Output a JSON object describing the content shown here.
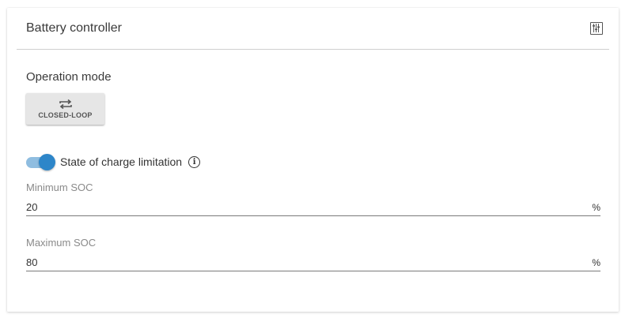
{
  "card": {
    "title": "Battery controller",
    "settings_icon": "sliders-icon"
  },
  "operation_mode": {
    "label": "Operation mode",
    "button_label": "CLOSED-LOOP",
    "button_icon": "repeat-icon"
  },
  "soc_limitation": {
    "label": "State of charge limitation",
    "enabled": true,
    "info_icon": "info-icon",
    "accent": "#2d86c9",
    "minimum": {
      "label": "Minimum SOC",
      "value": "20",
      "unit": "%"
    },
    "maximum": {
      "label": "Maximum SOC",
      "value": "80",
      "unit": "%"
    }
  }
}
